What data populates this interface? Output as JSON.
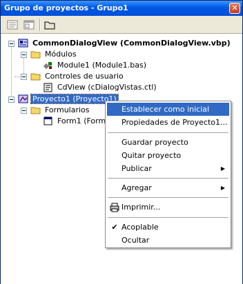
{
  "window": {
    "title": "Grupo de proyectos - Grupo1",
    "close_glyph": "✕"
  },
  "toolbar": {
    "buttons": [
      "view-code-icon",
      "view-object-icon",
      "toggle-folders-icon"
    ]
  },
  "tree": {
    "root": {
      "label": "CommonDialogView (CommonDialogView.vbp)"
    },
    "modules_folder": {
      "label": "Módulos"
    },
    "module1": {
      "label": "Module1 (Module1.bas)"
    },
    "controls_folder": {
      "label": "Controles de usuario"
    },
    "cdview": {
      "label": "CdView (cDialogVistas.ctl)"
    },
    "proyecto1": {
      "label": "Proyecto1 (Proyecto1)"
    },
    "forms_folder": {
      "label": "Formularios"
    },
    "form1": {
      "label": "Form1 (Form1)"
    }
  },
  "context_menu": {
    "items": [
      {
        "label": "Establecer como inicial"
      },
      {
        "label": "Propiedades de Proyecto1..."
      },
      {
        "label": "Guardar proyecto"
      },
      {
        "label": "Quitar proyecto"
      },
      {
        "label": "Publicar"
      },
      {
        "label": "Agregar"
      },
      {
        "label": "Imprimir..."
      },
      {
        "label": "Acoplable"
      },
      {
        "label": "Ocultar"
      }
    ],
    "submenu_arrow": "▶",
    "check_glyph": "✔"
  },
  "colors": {
    "titlebar": "#0058e6",
    "highlight": "#316ac5",
    "folder": "#f5d76e"
  }
}
